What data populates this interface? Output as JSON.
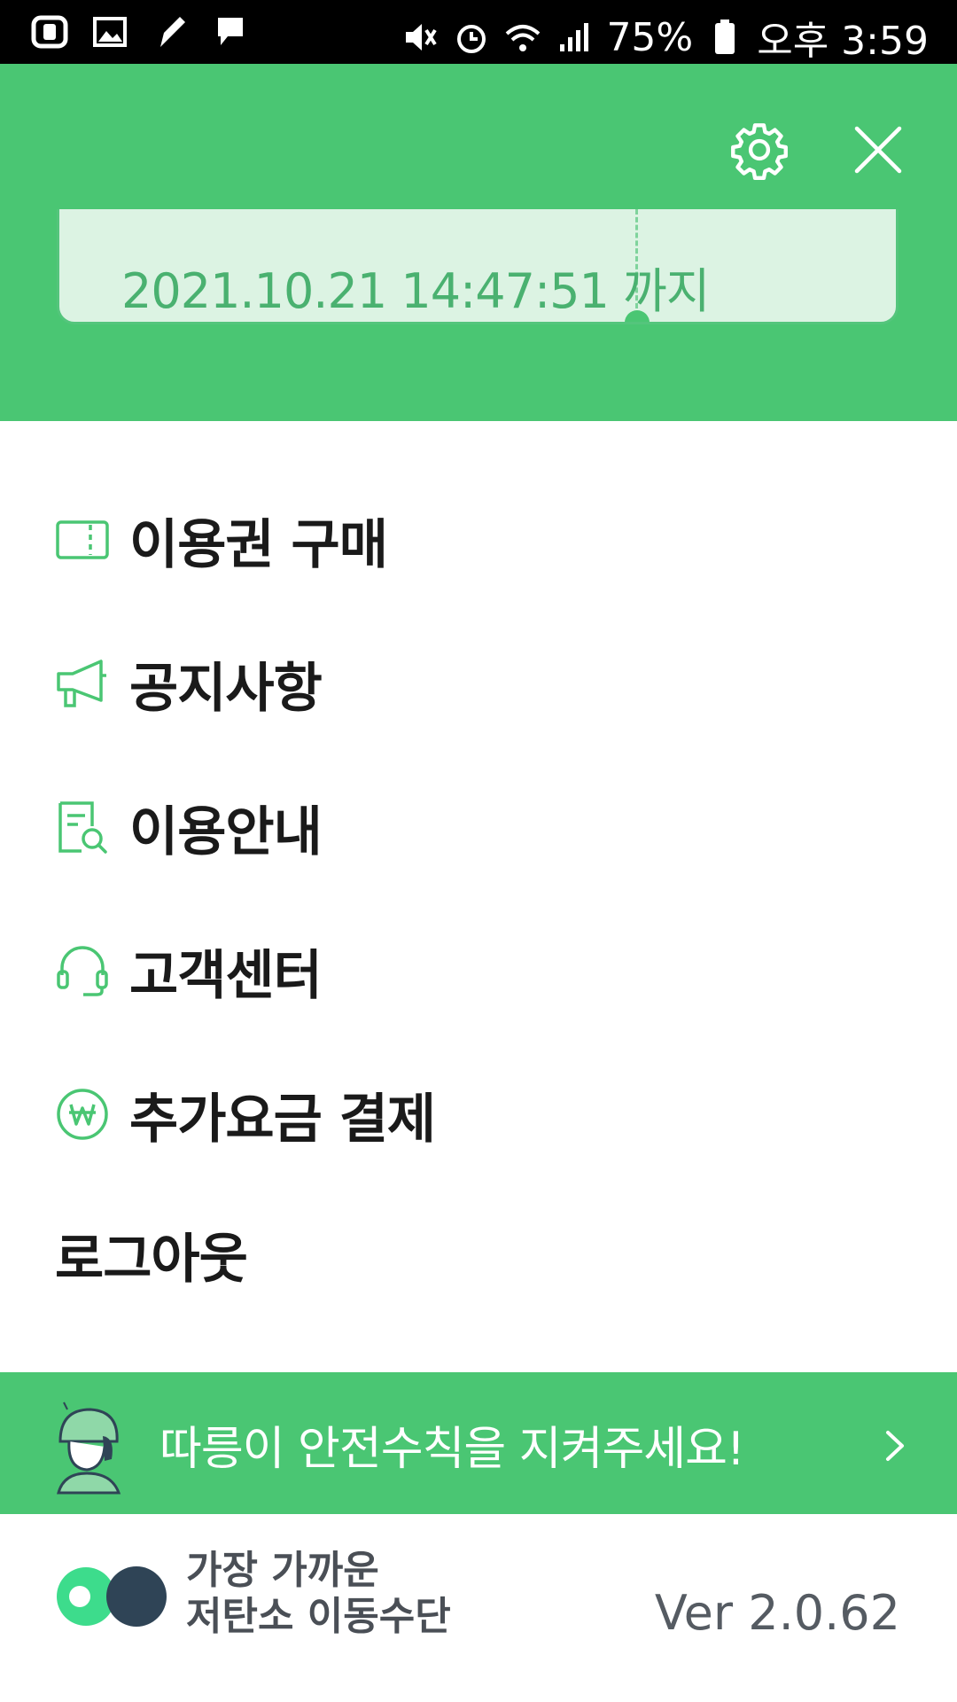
{
  "status_bar": {
    "battery_percent": "75%",
    "time": "오후 3:59"
  },
  "header": {
    "ticket_peek_text": "",
    "ticket_expiry": "2021.10.21 14:47:51 까지",
    "settings_icon": "gear-icon",
    "close_icon": "close-icon"
  },
  "menu": {
    "items": [
      {
        "label": "이용권 구매",
        "icon": "ticket-icon"
      },
      {
        "label": "공지사항",
        "icon": "megaphone-icon"
      },
      {
        "label": "이용안내",
        "icon": "document-search-icon"
      },
      {
        "label": "고객센터",
        "icon": "headset-icon"
      },
      {
        "label": "추가요금 결제",
        "icon": "won-icon"
      },
      {
        "label": "로그아웃",
        "icon": ""
      }
    ]
  },
  "banner": {
    "text": "따릉이 안전수칙을 지켜주세요!"
  },
  "footer": {
    "tagline_line1": "가장 가까운",
    "tagline_line2": "저탄소 이동수단",
    "version": "Ver 2.0.62"
  },
  "colors": {
    "brand_green": "#4ac673",
    "ticket_bg": "#dcf3e3",
    "logo_dark": "#2f4456"
  }
}
